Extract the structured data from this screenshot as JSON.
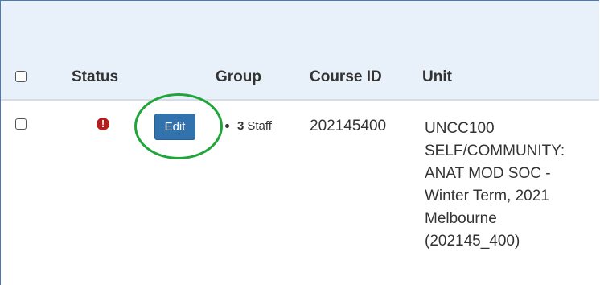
{
  "table": {
    "headers": {
      "status": "Status",
      "group": "Group",
      "course_id": "Course ID",
      "unit": "Unit"
    },
    "rows": [
      {
        "status_icon": "alert-circle-icon",
        "status_glyph": "!",
        "edit_label": "Edit",
        "group_count": "3",
        "group_label": "Staff",
        "course_id": "202145400",
        "unit_lines": [
          "UNCC100",
          "SELF/COMMUNITY:",
          "ANAT MOD SOC -",
          "Winter Term, 2021",
          "Melbourne",
          "(202145_400)"
        ]
      }
    ]
  },
  "colors": {
    "header_bg": "#e8f0f9",
    "status_error": "#b81d1d",
    "edit_button": "#3273ae",
    "highlight": "#1fa53a",
    "frame_border": "#4a7ab5"
  }
}
